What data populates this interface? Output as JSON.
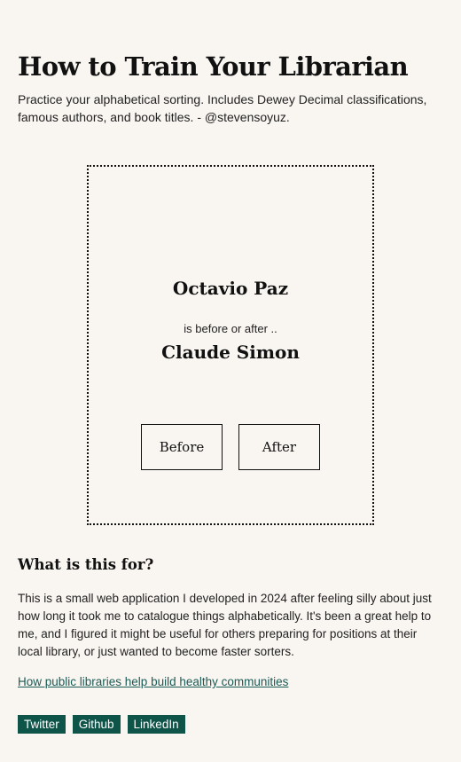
{
  "header": {
    "title": "How to Train Your Librarian",
    "intro": "Practice your alphabetical sorting. Includes Dewey Decimal classifications, famous authors, and book titles. - @stevensoyuz."
  },
  "quiz": {
    "subject": "Octavio Paz",
    "prompt": "is before or after ..",
    "target": "Claude Simon",
    "before_label": "Before",
    "after_label": "After"
  },
  "about": {
    "heading": "What is this for?",
    "body": "This is a small web application I developed in 2024 after feeling silly about just how long it took me to catalogue things alphabetically. It's been a great help to me, and I figured it might be useful for others preparing for positions at their local library, or just wanted to become faster sorters.",
    "link_label": "How public libraries help build healthy communities"
  },
  "social": {
    "twitter_label": "Twitter",
    "github_label": "Github",
    "linkedin_label": "LinkedIn"
  },
  "colors": {
    "background": "#f9f6f2",
    "social_button": "#0e5449",
    "link": "#1a5a55"
  }
}
